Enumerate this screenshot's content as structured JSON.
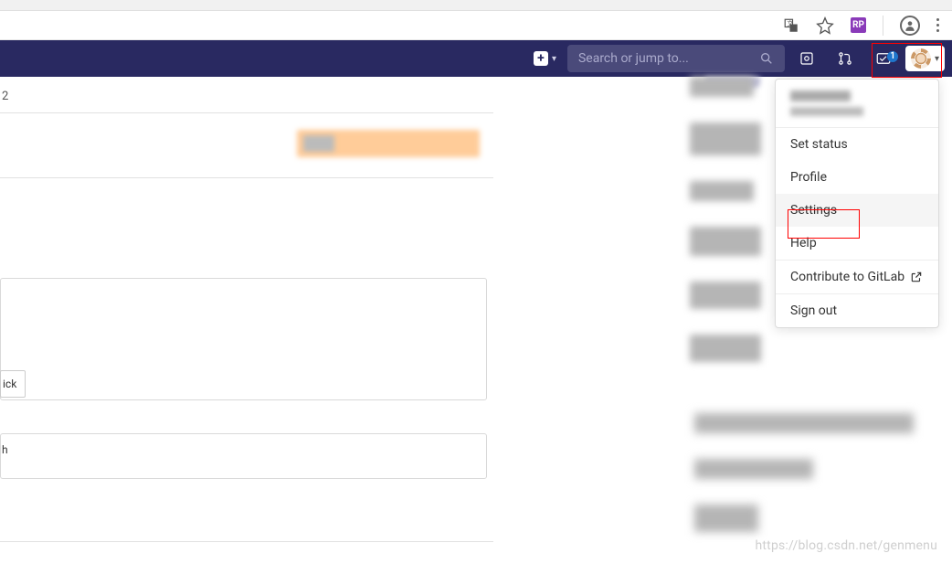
{
  "browser": {
    "icons": {
      "translate": "translate-icon",
      "star": "star-icon",
      "rp": "RP",
      "profile": "profile-icon",
      "menu": "menu-icon"
    }
  },
  "navbar": {
    "plus_icon": "+",
    "search_placeholder": "Search or jump to...",
    "todos_badge": "1"
  },
  "dropdown": {
    "items": {
      "set_status": "Set status",
      "profile": "Profile",
      "settings": "Settings",
      "help": "Help",
      "contribute": "Contribute to GitLab",
      "sign_out": "Sign out"
    }
  },
  "left": {
    "line1": "2",
    "box_label_1": "ick",
    "box_label_2": "h"
  },
  "watermark": "https://blog.csdn.net/genmenu"
}
